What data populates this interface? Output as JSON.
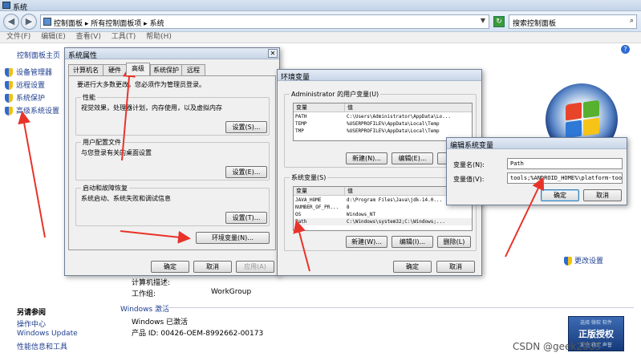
{
  "window": {
    "title": "系统"
  },
  "address": {
    "crumb1": "控制面板",
    "crumb2": "所有控制面板项",
    "crumb3": "系统",
    "search_placeholder": "搜索控制面板"
  },
  "menu": [
    "文件(F)",
    "编辑(E)",
    "查看(V)",
    "工具(T)",
    "帮助(H)"
  ],
  "leftnav": {
    "home": "控制面板主页",
    "items": [
      "设备管理器",
      "远程设置",
      "系统保护",
      "高级系统设置"
    ],
    "see_also": "另请参阅",
    "see_also_items": [
      "操作中心",
      "Windows Update",
      "性能信息和工具"
    ]
  },
  "system_page": {
    "change_settings": "更改设置",
    "computer_desc_label": "计算机描述:",
    "workgroup_label": "工作组:",
    "workgroup_value": "WorkGroup",
    "activation_title": "Windows 激活",
    "activated": "Windows 已激活",
    "product_id": "产品 ID: 00426-OEM-8992662-00173",
    "genuine_top": "选择 微软 软件",
    "genuine_main": "正版授权",
    "genuine_sub": "安全 稳定 声誉",
    "watermark": "CSDN @geek2003"
  },
  "sysprops": {
    "title": "系统属性",
    "tabs": [
      "计算机名",
      "硬件",
      "高级",
      "系统保护",
      "远程"
    ],
    "admin_note": "要进行大多数更改，您必须作为管理员登录。",
    "perf_label": "性能",
    "perf_text": "视觉效果，处理器计划，内存使用，以及虚拟内存",
    "perf_btn": "设置(S)...",
    "profile_label": "用户配置文件",
    "profile_text": "与您登录有关的桌面设置",
    "profile_btn": "设置(E)...",
    "startup_label": "启动和故障恢复",
    "startup_text": "系统启动、系统失败和调试信息",
    "startup_btn": "设置(T)...",
    "env_btn": "环境变量(N)...",
    "ok": "确定",
    "cancel": "取消",
    "apply": "应用(A)"
  },
  "envvars": {
    "title": "环境变量",
    "user_group": "Administrator 的用户变量(U)",
    "col_var": "变量",
    "col_val": "值",
    "user_rows": [
      {
        "name": "PATH",
        "value": "C:\\Users\\Administrator\\AppData\\Lo..."
      },
      {
        "name": "TEMP",
        "value": "%USERPROFILE%\\AppData\\Local\\Temp"
      },
      {
        "name": "TMP",
        "value": "%USERPROFILE%\\AppData\\Local\\Temp"
      }
    ],
    "user_new": "新建(N)...",
    "user_edit": "编辑(E)...",
    "user_delete": "删除",
    "sys_group": "系统变量(S)",
    "sys_rows": [
      {
        "name": "JAVA_HOME",
        "value": "d:\\Program Files\\Java\\jdk-14.0..."
      },
      {
        "name": "NUMBER_OF_PR...",
        "value": "8"
      },
      {
        "name": "OS",
        "value": "Windows_NT"
      },
      {
        "name": "Path",
        "value": "C:\\Windows\\system32;C:\\Windows;..."
      }
    ],
    "sys_new": "新建(W)...",
    "sys_edit": "编辑(I)...",
    "sys_delete": "删除(L)",
    "ok": "确定",
    "cancel": "取消"
  },
  "editvar": {
    "title": "编辑系统变量",
    "name_label": "变量名(N):",
    "name_value": "Path",
    "value_label": "变量值(V):",
    "value_value": "tools;%ANDROID_HOME%\\platform-tools",
    "ok": "确定",
    "cancel": "取消"
  },
  "colors": {
    "link": "#1d3d8f",
    "arrow": "#e8332a",
    "title_gradient_top": "#d9e4f1"
  }
}
